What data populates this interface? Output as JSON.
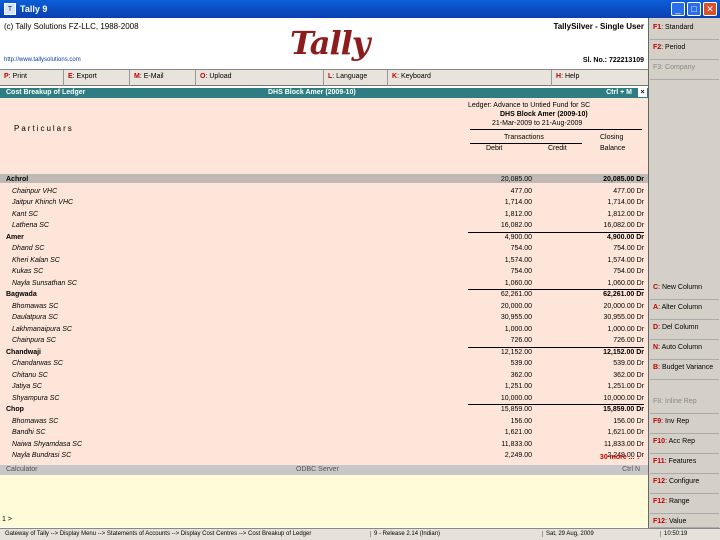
{
  "window": {
    "title": "Tally 9",
    "icon_text": "T"
  },
  "header": {
    "copyright": "(c) Tally Solutions FZ-LLC, 1988-2008",
    "url": "http://www.tallysolutions.com",
    "logo": "Tally",
    "edition": "TallySilver - Single User",
    "serial": "Sl. No.: 722213109"
  },
  "menubar": [
    {
      "key": "P",
      "label": ": Print"
    },
    {
      "key": "E",
      "label": ": Export"
    },
    {
      "key": "M",
      "label": ": E-Mail"
    },
    {
      "key": "O",
      "label": ": Upload"
    },
    {
      "key": "L",
      "label": ": Language"
    },
    {
      "key": "K",
      "label": ": Keyboard"
    },
    {
      "key": "H",
      "label": ": Help"
    }
  ],
  "rightbar_top": [
    {
      "key": "F1",
      "label": ": Standard"
    },
    {
      "key": "F2",
      "label": ": Period"
    },
    {
      "key": "F3",
      "label": ": Company"
    }
  ],
  "rightbar_mid": [
    {
      "key": "C",
      "label": ": New Column"
    },
    {
      "key": "A",
      "label": ": Alter Column"
    },
    {
      "key": "D",
      "label": ": Del Column"
    },
    {
      "key": "N",
      "label": ": Auto Column"
    },
    {
      "key": "B",
      "label": ": Budget Variance"
    }
  ],
  "rightbar_bottom": [
    {
      "key": "F8",
      "label": ": Inline Rep"
    },
    {
      "key": "F9",
      "label": ": Inv Rep"
    },
    {
      "key": "F10",
      "label": ": Acc Rep"
    },
    {
      "key": "F11",
      "label": ": Features"
    },
    {
      "key": "F12",
      "label": ": Configure"
    },
    {
      "key": "F12",
      "label": ": Range"
    },
    {
      "key": "F12",
      "label": ": Value"
    }
  ],
  "report": {
    "title": "Cost Breakup of Ledger",
    "center": "DHS Block Amer (2009-10)",
    "shortcut": "Ctrl + M",
    "ledger": "Ledger: Advance to Untied Fund for SC",
    "cost_centre": "DHS Block Amer (2009-10)",
    "period": "21-Mar-2009 to 21-Aug-2009",
    "particulars": "Particulars",
    "transactions": "Transactions",
    "debit": "Debit",
    "credit": "Credit",
    "closing": "Closing",
    "balance": "Balance",
    "more": "30 more ... ↓"
  },
  "rows": [
    {
      "name": "Achrol",
      "debit": "20,085.00",
      "balance": "20,085.00 Dr",
      "type": "grp"
    },
    {
      "name": "Chainpur VHC",
      "debit": "477.00",
      "balance": "477.00 Dr",
      "type": "sub"
    },
    {
      "name": "Jaitpur Khinch VHC",
      "debit": "1,714.00",
      "balance": "1,714.00 Dr",
      "type": "sub"
    },
    {
      "name": "Kant SC",
      "debit": "1,812.00",
      "balance": "1,812.00 Dr",
      "type": "sub"
    },
    {
      "name": "Lathena SC",
      "debit": "16,082.00",
      "balance": "16,082.00 Dr",
      "type": "sub"
    },
    {
      "name": "Amer",
      "debit": "4,900.00",
      "balance": "4,900.00 Dr",
      "type": "grp"
    },
    {
      "name": "Dhand SC",
      "debit": "754.00",
      "balance": "754.00 Dr",
      "type": "sub"
    },
    {
      "name": "Kheri Kalan SC",
      "debit": "1,574.00",
      "balance": "1,574.00 Dr",
      "type": "sub"
    },
    {
      "name": "Kukas SC",
      "debit": "754.00",
      "balance": "754.00 Dr",
      "type": "sub"
    },
    {
      "name": "Nayla Sunsathan SC",
      "debit": "1,060.00",
      "balance": "1,060.00 Dr",
      "type": "sub"
    },
    {
      "name": "Bagwada",
      "debit": "62,261.00",
      "balance": "62,261.00 Dr",
      "type": "grp"
    },
    {
      "name": "Bhomawas SC",
      "debit": "20,000.00",
      "balance": "20,000.00 Dr",
      "type": "sub"
    },
    {
      "name": "Daulatpura SC",
      "debit": "30,955.00",
      "balance": "30,955.00 Dr",
      "type": "sub"
    },
    {
      "name": "Lakhmanaipura SC",
      "debit": "1,000.00",
      "balance": "1,000.00 Dr",
      "type": "sub"
    },
    {
      "name": "Chainpura SC",
      "debit": "726.00",
      "balance": "726.00 Dr",
      "type": "sub"
    },
    {
      "name": "Chandwaji",
      "debit": "12,152.00",
      "balance": "12,152.00 Dr",
      "type": "grp"
    },
    {
      "name": "Chandarwas SC",
      "debit": "539.00",
      "balance": "539.00 Dr",
      "type": "sub"
    },
    {
      "name": "Chitanu SC",
      "debit": "362.00",
      "balance": "362.00 Dr",
      "type": "sub"
    },
    {
      "name": "Jatiya SC",
      "debit": "1,251.00",
      "balance": "1,251.00 Dr",
      "type": "sub"
    },
    {
      "name": "Shyampura SC",
      "debit": "10,000.00",
      "balance": "10,000.00 Dr",
      "type": "sub"
    },
    {
      "name": "Chop",
      "debit": "15,859.00",
      "balance": "15,859.00 Dr",
      "type": "grp"
    },
    {
      "name": "Bhomawas SC",
      "debit": "156.00",
      "balance": "156.00 Dr",
      "type": "sub"
    },
    {
      "name": "Bandhi SC",
      "debit": "1,621.00",
      "balance": "1,621.00 Dr",
      "type": "sub"
    },
    {
      "name": "Naiwa Shyamdasa SC",
      "debit": "11,833.00",
      "balance": "11,833.00 Dr",
      "type": "sub"
    },
    {
      "name": "Nayla Bundrasi SC",
      "debit": "2,249.00",
      "balance": "2,249.00 Dr",
      "type": "sub"
    }
  ],
  "calculator": {
    "label": "Calculator",
    "odbc": "ODBC Server",
    "ctrl": "Ctrl N",
    "cursor": "1 >"
  },
  "status": {
    "path": "Gateway of Tally --> Display Menu --> Statements of Accounts --> Display Cost Centres --> Cost Breakup of Ledger",
    "release": "9 - Release 2.14 (Indian)",
    "date": "Sat, 29 Aug, 2009",
    "time": "10:50:19"
  }
}
